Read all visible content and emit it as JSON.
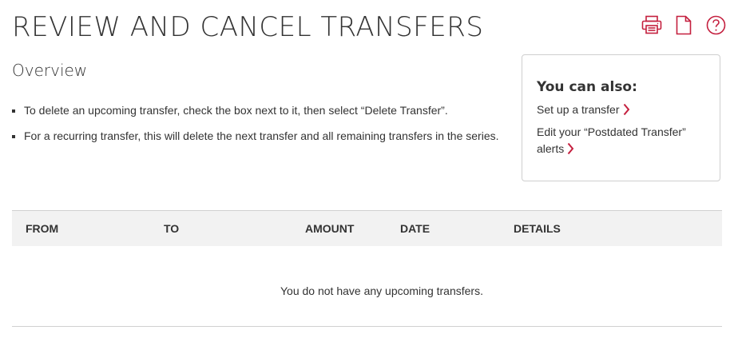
{
  "page": {
    "title": "REVIEW AND CANCEL TRANSFERS"
  },
  "header_icons": [
    {
      "name": "print-icon",
      "color": "#c41f3e"
    },
    {
      "name": "document-icon",
      "color": "#c41f3e"
    },
    {
      "name": "help-icon",
      "color": "#c41f3e"
    }
  ],
  "overview": {
    "heading": "Overview",
    "items": [
      "To delete an upcoming transfer, check the box next to it, then select “Delete Transfer”.",
      "For a recurring transfer, this will delete the next transfer and all remaining transfers in the series."
    ]
  },
  "aside": {
    "title": "You can also:",
    "links": [
      {
        "label": "Set up a transfer",
        "icon": "chevron-right-icon"
      },
      {
        "label": "Edit your “Postdated Transfer” alerts",
        "icon": "chevron-right-icon"
      }
    ]
  },
  "table": {
    "columns": [
      "FROM",
      "TO",
      "AMOUNT",
      "DATE",
      "DETAILS"
    ],
    "empty_message": "You do not have any upcoming transfers."
  },
  "colors": {
    "accent": "#c41f3e",
    "text": "#333333",
    "header_bg": "#f2f2f2",
    "border": "#d0d0d0"
  }
}
